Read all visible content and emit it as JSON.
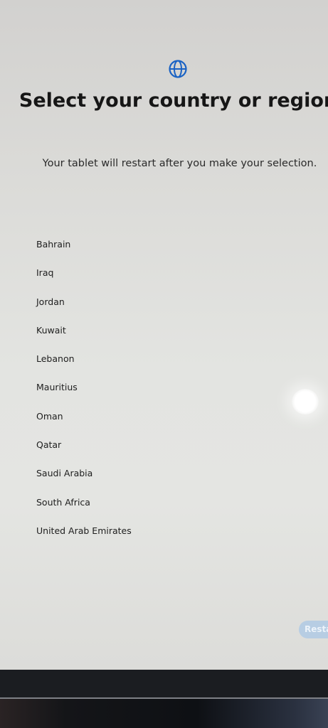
{
  "header": {
    "icon": "globe-icon",
    "title": "Select your country or region",
    "subtitle": "Your tablet will restart after you make your selection."
  },
  "countries": [
    "Bahrain",
    "Iraq",
    "Jordan",
    "Kuwait",
    "Lebanon",
    "Mauritius",
    "Oman",
    "Qatar",
    "Saudi Arabia",
    "South Africa",
    "United Arab Emirates"
  ],
  "footer": {
    "restart_label": "Restart",
    "button_color": "#b7cde3"
  },
  "colors": {
    "accent": "#1a62c4",
    "text": "#161616"
  }
}
